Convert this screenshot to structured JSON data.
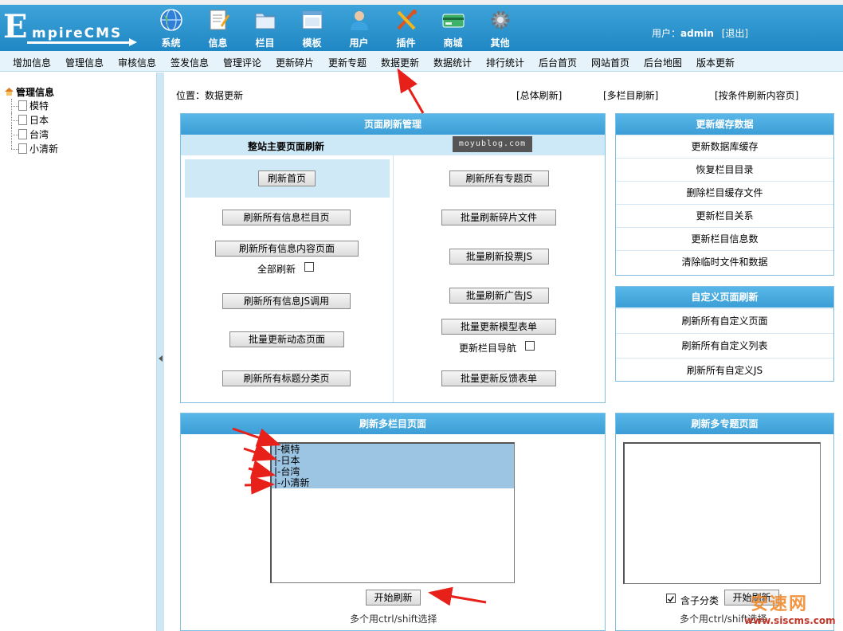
{
  "app": {
    "logo_first": "E",
    "logo_rest": "mpireCMS"
  },
  "topnav": [
    {
      "label": "系统",
      "icon": "globe-icon"
    },
    {
      "label": "信息",
      "icon": "document-icon"
    },
    {
      "label": "栏目",
      "icon": "folder-icon"
    },
    {
      "label": "模板",
      "icon": "window-icon"
    },
    {
      "label": "用户",
      "icon": "user-icon"
    },
    {
      "label": "插件",
      "icon": "tools-icon"
    },
    {
      "label": "商城",
      "icon": "card-icon"
    },
    {
      "label": "其他",
      "icon": "gear-icon"
    }
  ],
  "user": {
    "prefix": "用户：",
    "name": "admin",
    "logout": "[退出]"
  },
  "menubar": [
    "增加信息",
    "管理信息",
    "审核信息",
    "签发信息",
    "管理评论",
    "更新碎片",
    "更新专题",
    "数据更新",
    "数据统计",
    "排行统计",
    "后台首页",
    "网站首页",
    "后台地图",
    "版本更新"
  ],
  "tree": {
    "root": "管理信息",
    "nodes": [
      "模特",
      "日本",
      "台湾",
      "小清新"
    ]
  },
  "location": "位置：数据更新",
  "top_links": [
    "[总体刷新]",
    "[多栏目刷新]",
    "[按条件刷新内容页]"
  ],
  "page_refresh": {
    "title": "页面刷新管理",
    "subtitle": "整站主要页面刷新",
    "watermark": "moyublog.com",
    "refresh_home": "刷新首页",
    "left_buttons": [
      "刷新所有信息栏目页",
      "刷新所有信息内容页面",
      "刷新所有信息JS调用",
      "批量更新动态页面",
      "刷新所有标题分类页"
    ],
    "all_refresh_label": "全部刷新",
    "right_buttons": [
      "刷新所有专题页",
      "批量刷新碎片文件",
      "批量刷新投票JS",
      "批量刷新广告JS",
      "批量更新模型表单",
      "批量更新反馈表单"
    ],
    "nav_refresh_label": "更新栏目导航"
  },
  "cache": {
    "title": "更新缓存数据",
    "items": [
      "更新数据库缓存",
      "恢复栏目目录",
      "删除栏目缓存文件",
      "更新栏目关系",
      "更新栏目信息数",
      "清除临时文件和数据"
    ]
  },
  "custom": {
    "title": "自定义页面刷新",
    "items": [
      "刷新所有自定义页面",
      "刷新所有自定义列表",
      "刷新所有自定义JS"
    ]
  },
  "multi_column": {
    "title": "刷新多栏目页面",
    "options": [
      "|-模特",
      "|-日本",
      "|-台湾",
      "|-小清新"
    ],
    "start": "开始刷新",
    "hint": "多个用ctrl/shift选择"
  },
  "multi_topic": {
    "title": "刷新多专题页面",
    "include_sub": "含子分类",
    "start": "开始刷新",
    "hint": "多个用ctrl/shift选择"
  },
  "site_watermark": {
    "line1": "安速网",
    "line2": "www.siscms.com"
  },
  "colors": {
    "header": "#2a94cf",
    "panel_header": "#4aaee0",
    "arrow": "#e8201a"
  }
}
